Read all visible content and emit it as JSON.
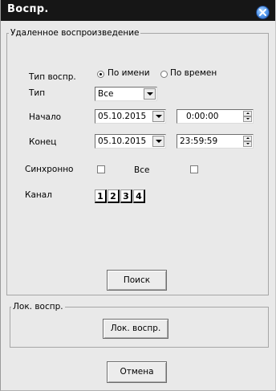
{
  "window": {
    "title": "Воспр."
  },
  "remote": {
    "legend": "Удаленное воспроизведение",
    "type_label": "Тип воспр.",
    "radio_by_name": "По имени",
    "radio_by_time": "По времен",
    "kind_label": "Тип",
    "kind_value": "Все",
    "start_label": "Начало",
    "start_date": "05.10.2015",
    "start_time": "0:00:00",
    "end_label": "Конец",
    "end_date": "05.10.2015",
    "end_time": "23:59:59",
    "sync_label": "Синхронно",
    "all_label": "Все",
    "channel_label": "Канал",
    "channels": [
      "1",
      "2",
      "3",
      "4"
    ],
    "search_button": "Поиск"
  },
  "local": {
    "legend": "Лок. воспр.",
    "button": "Лок. воспр."
  },
  "cancel_button": "Отмена"
}
